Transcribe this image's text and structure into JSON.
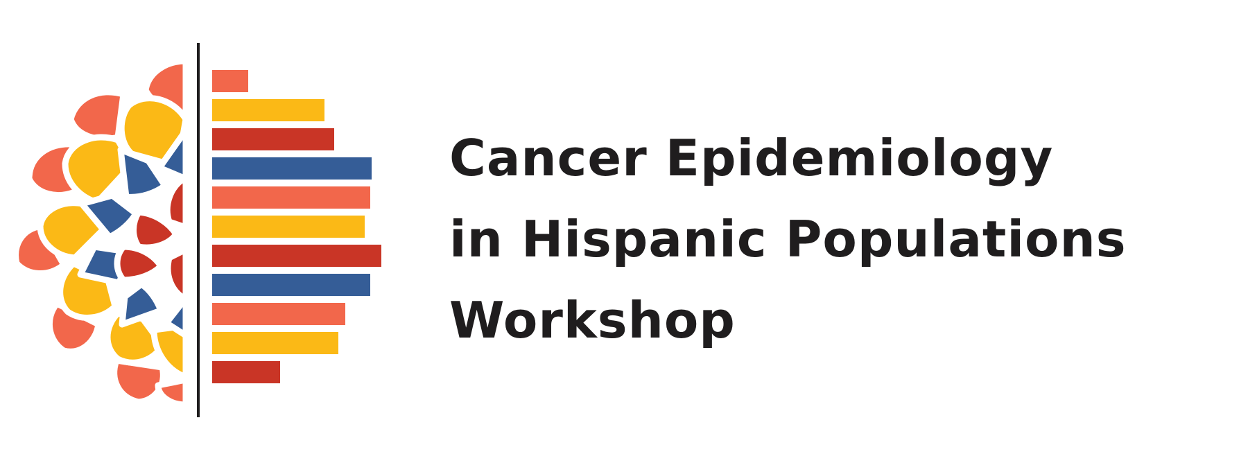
{
  "logo": {
    "title_lines": [
      "Cancer Epidemiology",
      "in Hispanic Populations",
      "Workshop"
    ],
    "colors": {
      "coral": "#f2674b",
      "yellow": "#fbb916",
      "red": "#c93526",
      "blue": "#355d97",
      "text": "#1f1d1e",
      "divider": "#1f1d1e"
    },
    "stripe_colors": [
      "coral",
      "yellow",
      "red",
      "blue",
      "coral",
      "yellow",
      "red",
      "blue",
      "coral",
      "yellow",
      "red"
    ],
    "icons": [
      "half-flower-icon",
      "stripes-icon",
      "divider-line"
    ]
  }
}
